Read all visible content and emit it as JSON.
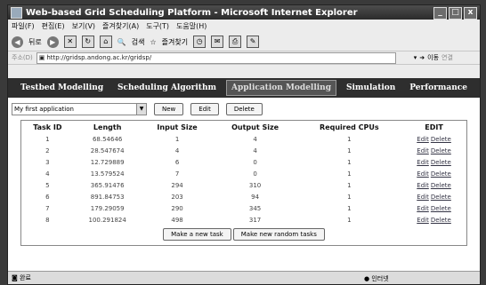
{
  "window": {
    "title": "Web-based Grid Scheduling Platform - Microsoft Internet Explorer",
    "controls": [
      "_",
      "□",
      "x"
    ]
  },
  "menu": [
    "파일(F)",
    "편집(E)",
    "보기(V)",
    "즐겨찾기(A)",
    "도구(T)",
    "도움말(H)"
  ],
  "toolbar": {
    "back": "뒤로",
    "search": "검색",
    "favorites": "즐겨찾기"
  },
  "address": {
    "label": "주소(D)",
    "url": "http://gridsp.andong.ac.kr/gridsp/",
    "go": "이동",
    "links": "연결"
  },
  "nav": [
    {
      "label": "Testbed Modelling",
      "active": false
    },
    {
      "label": "Scheduling Algorithm",
      "active": false
    },
    {
      "label": "Application Modelling",
      "active": true
    },
    {
      "label": "Simulation",
      "active": false
    },
    {
      "label": "Performance",
      "active": false
    }
  ],
  "app_select": {
    "value": "My first application"
  },
  "buttons": {
    "new": "New",
    "edit": "Edit",
    "delete": "Delete",
    "make_task": "Make a new task",
    "make_random": "Make new random tasks"
  },
  "table": {
    "headers": [
      "Task ID",
      "Length",
      "Input Size",
      "Output Size",
      "Required CPUs",
      "EDIT"
    ],
    "edit_label": "Edit",
    "delete_label": "Delete",
    "rows": [
      [
        "1",
        "68.54646",
        "1",
        "4",
        "1"
      ],
      [
        "2",
        "28.547674",
        "4",
        "4",
        "1"
      ],
      [
        "3",
        "12.729889",
        "6",
        "0",
        "1"
      ],
      [
        "4",
        "13.579524",
        "7",
        "0",
        "1"
      ],
      [
        "5",
        "365.91476",
        "294",
        "310",
        "1"
      ],
      [
        "6",
        "891.84753",
        "203",
        "94",
        "1"
      ],
      [
        "7",
        "179.29059",
        "290",
        "345",
        "1"
      ],
      [
        "8",
        "100.291824",
        "498",
        "317",
        "1"
      ]
    ]
  },
  "status": {
    "left": "완료",
    "zone": "인터넷"
  }
}
